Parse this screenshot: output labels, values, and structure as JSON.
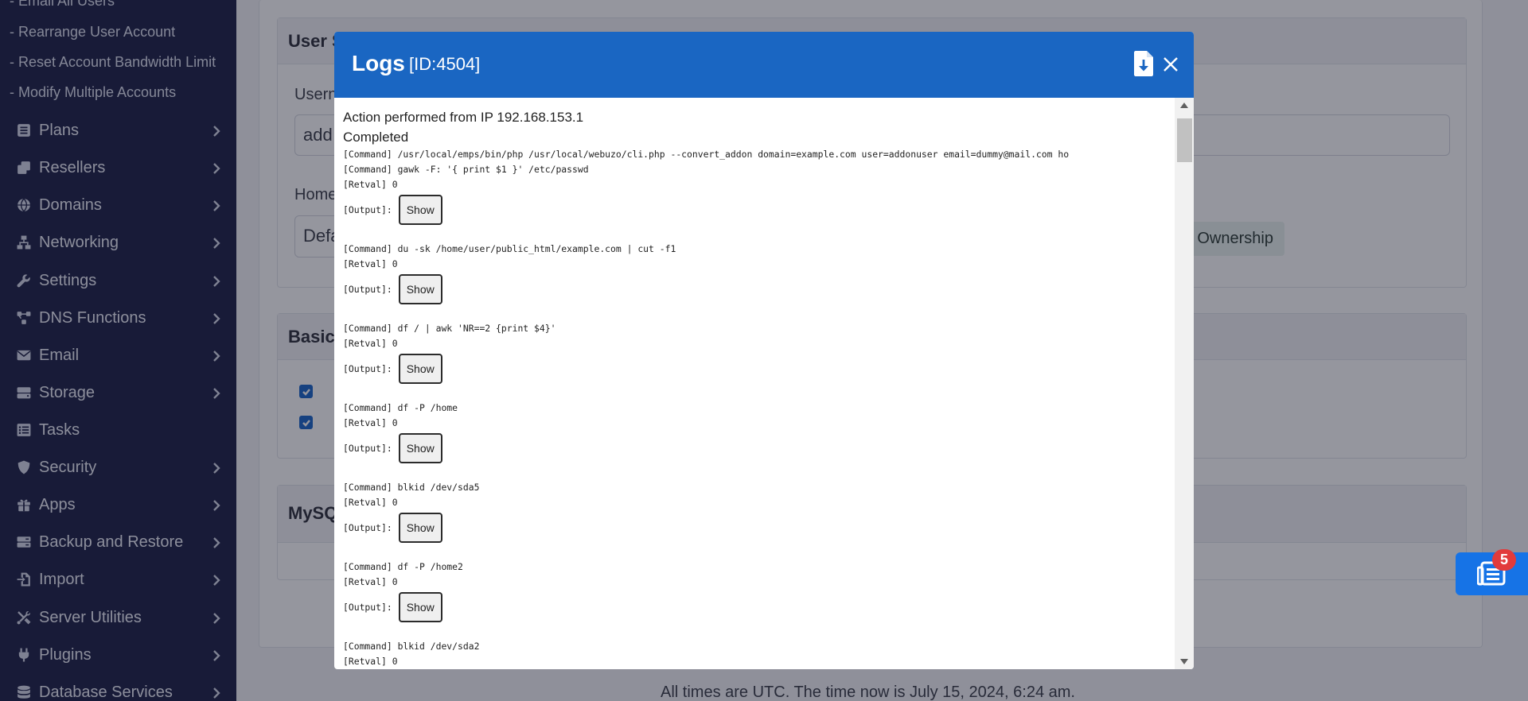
{
  "sidebar": {
    "sub_items": [
      {
        "label": "- Email All Users"
      },
      {
        "label": "- Rearrange User Account"
      },
      {
        "label": "- Reset Account Bandwidth Limit"
      },
      {
        "label": "- Modify Multiple Accounts"
      }
    ],
    "items": [
      {
        "label": "Plans",
        "icon": "list-icon",
        "has_chevron": true
      },
      {
        "label": "Resellers",
        "icon": "copy-icon",
        "has_chevron": true
      },
      {
        "label": "Domains",
        "icon": "globe-icon",
        "has_chevron": true
      },
      {
        "label": "Networking",
        "icon": "network-icon",
        "has_chevron": true
      },
      {
        "label": "Settings",
        "icon": "wrench-icon",
        "has_chevron": true
      },
      {
        "label": "DNS Functions",
        "icon": "nodes-icon",
        "has_chevron": true
      },
      {
        "label": "Email",
        "icon": "envelope-icon",
        "has_chevron": true
      },
      {
        "label": "Storage",
        "icon": "hdd-icon",
        "has_chevron": true
      },
      {
        "label": "Tasks",
        "icon": "tasks-icon",
        "has_chevron": false
      },
      {
        "label": "Security",
        "icon": "shield-icon",
        "has_chevron": true
      },
      {
        "label": "Apps",
        "icon": "gift-icon",
        "has_chevron": true
      },
      {
        "label": "Backup and Restore",
        "icon": "server-icon",
        "has_chevron": true
      },
      {
        "label": "Import",
        "icon": "file-import-icon",
        "has_chevron": true
      },
      {
        "label": "Server Utilities",
        "icon": "tools-icon",
        "has_chevron": true
      },
      {
        "label": "Plugins",
        "icon": "plug-icon",
        "has_chevron": true
      },
      {
        "label": "Database Services",
        "icon": "database-icon",
        "has_chevron": true
      }
    ]
  },
  "background": {
    "user_section_title": "User S",
    "username_label": "Usern",
    "username_value": "add",
    "home_label": "Home",
    "home_value": "Defa",
    "ownership_label": "rve Ownership",
    "basic_section_title": "Basic",
    "mysql_section_title": "MySQ",
    "footer": "All times are UTC. The time now is July 15, 2024, 6:24 am."
  },
  "notification": {
    "count": "5",
    "icon": "tasks-list-icon"
  },
  "modal": {
    "title": "Logs",
    "id_label": "[ID:4504]",
    "summary_ip": "Action performed from IP 192.168.153.1",
    "summary_status": "Completed",
    "show_label": "Show",
    "output_label": "[Output]:",
    "entries": [
      {
        "command": "[Command] /usr/local/emps/bin/php /usr/local/webuzo/cli.php --convert_addon domain=example.com user=addonuser email=dummy@mail.com ho",
        "retval": "[Retval] 0"
      },
      {
        "command": "[Command] gawk -F: '{ print $1 }' /etc/passwd",
        "retval": "[Retval] 0"
      },
      {
        "command": "[Command] du -sk /home/user/public_html/example.com | cut -f1",
        "retval": "[Retval] 0"
      },
      {
        "command": "[Command] df / | awk 'NR==2 {print $4}'",
        "retval": "[Retval] 0"
      },
      {
        "command": "[Command] df -P /home",
        "retval": "[Retval] 0"
      },
      {
        "command": "[Command] blkid /dev/sda5",
        "retval": "[Retval] 0"
      },
      {
        "command": "[Command] df -P /home2",
        "retval": "[Retval] 0"
      },
      {
        "command": "[Command] blkid /dev/sda2",
        "retval": "[Retval] 0"
      }
    ]
  }
}
